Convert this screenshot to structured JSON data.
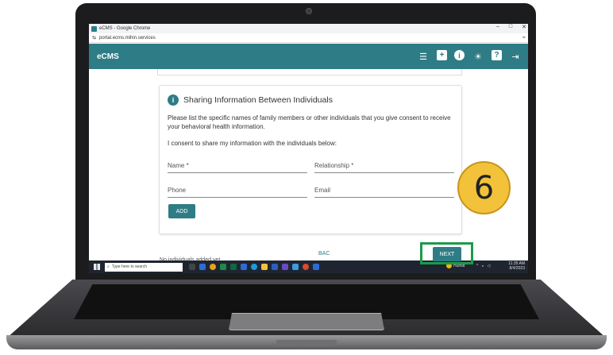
{
  "window": {
    "title": "eCMS - Google Chrome",
    "controls": [
      "–",
      "□",
      "✕"
    ]
  },
  "browser": {
    "url": "portal.ecms.mihin.services"
  },
  "app": {
    "brand": "eCMS",
    "icons": [
      "list-icon",
      "add-box-icon",
      "info-icon",
      "brightness-icon",
      "help-icon",
      "logout-icon"
    ]
  },
  "card": {
    "title": "Sharing Information Between Individuals",
    "description": "Please list the specific names of family members or other individuals that you give consent to receive your behavioral health information.",
    "consent_text": "I consent to share my information with the individuals below:",
    "fields": {
      "name": "Name *",
      "relationship": "Relationship *",
      "phone": "Phone",
      "email": "Email"
    },
    "add_label": "ADD"
  },
  "empty_text": "No individuals added yet.",
  "nav": {
    "back_label": "BAC",
    "next_label": "NEXT"
  },
  "taskbar": {
    "search_placeholder": "Type here to search",
    "weather": "Humid",
    "time": "11:35 AM",
    "date": "8/4/2023"
  },
  "step_number": "6",
  "colors": {
    "accent": "#2e7d86",
    "highlight": "#1a9b4a",
    "badge": "#f2c23a"
  }
}
